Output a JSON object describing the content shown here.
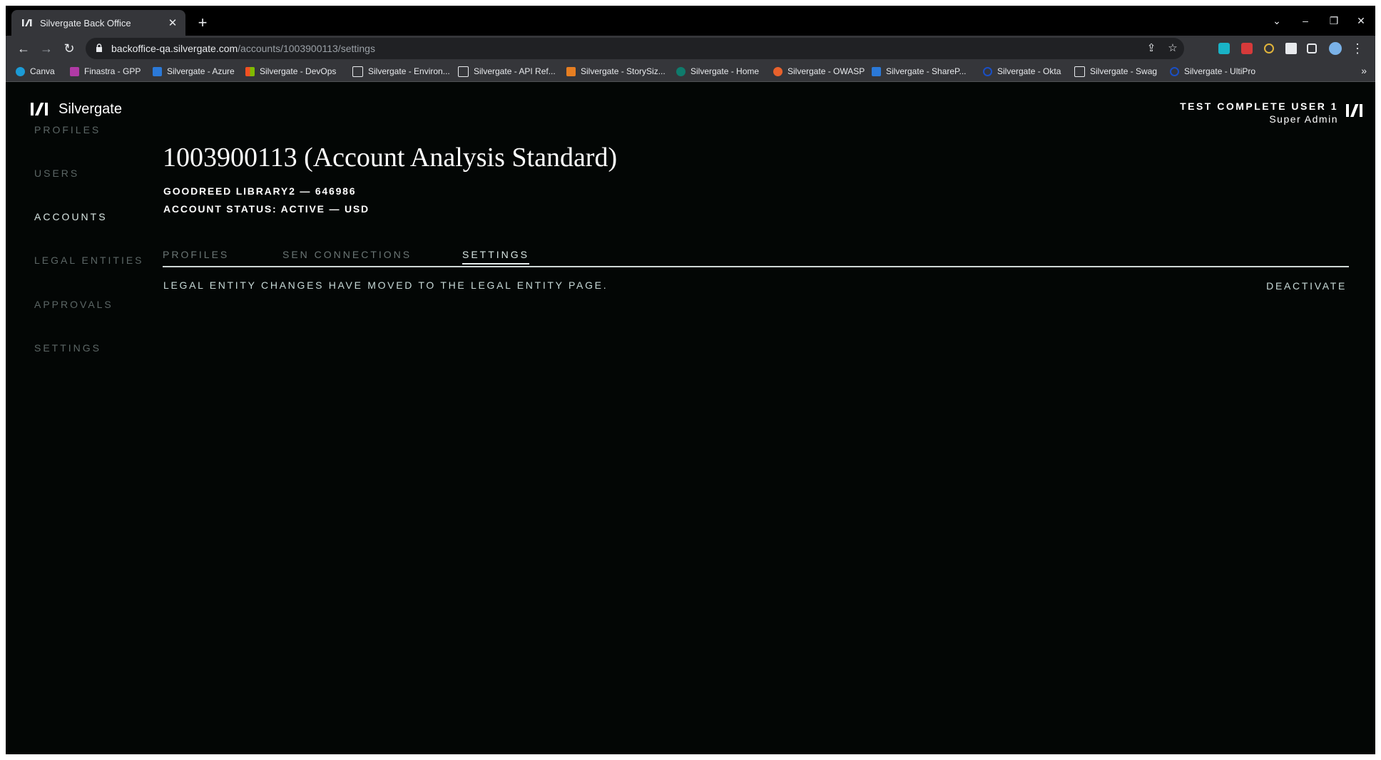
{
  "browser": {
    "tab_title": "Silvergate Back Office",
    "tab_close": "✕",
    "new_tab": "+",
    "url_host": "backoffice-qa.silvergate.com",
    "url_path": "/accounts/1003900113/settings",
    "window_controls": {
      "chevron": "⌄",
      "minimize": "–",
      "restore": "❐",
      "close": "✕"
    },
    "nav": {
      "back": "←",
      "forward": "→",
      "reload": "↻",
      "share": "⇪",
      "star": "☆",
      "menu": "⋮",
      "overflow": "»"
    },
    "bookmarks": [
      {
        "label": "Canva",
        "color": "#1c9bd6"
      },
      {
        "label": "Finastra - GPP",
        "color": "#b03aa5"
      },
      {
        "label": "Silvergate - Azure",
        "color": "#2b79d8"
      },
      {
        "label": "Silvergate - DevOps",
        "color": "#f25022"
      },
      {
        "label": "Silvergate - Environ...",
        "color": "#e8eaed"
      },
      {
        "label": "Silvergate - API Ref...",
        "color": "#e8eaed"
      },
      {
        "label": "Silvergate - StorySiz...",
        "color": "#e67e22"
      },
      {
        "label": "Silvergate - Home",
        "color": "#0f7b6c"
      },
      {
        "label": "Silvergate - OWASP",
        "color": "#e8612c"
      },
      {
        "label": "Silvergate - ShareP...",
        "color": "#2b79d8"
      },
      {
        "label": "Silvergate - Okta",
        "color": "#1a4fc4"
      },
      {
        "label": "Silvergate - Swag",
        "color": "#e8eaed"
      },
      {
        "label": "Silvergate - UltiPro",
        "color": "#1a4fc4"
      }
    ]
  },
  "app": {
    "brand": "Silvergate",
    "sidebar": [
      "PROFILES",
      "USERS",
      "ACCOUNTS",
      "LEGAL ENTITIES",
      "APPROVALS",
      "SETTINGS"
    ],
    "active_sidebar": "ACCOUNTS",
    "user": {
      "name": "TEST COMPLETE USER 1",
      "role": "Super Admin"
    },
    "account": {
      "title": "1003900113 (Account Analysis Standard)",
      "line1": "GOODREED LIBRARY2 — 646986",
      "line2": "ACCOUNT STATUS: ACTIVE — USD"
    },
    "tabs": [
      "PROFILES",
      "SEN CONNECTIONS",
      "SETTINGS"
    ],
    "active_tab": "SETTINGS",
    "notice": "LEGAL ENTITY CHANGES HAVE MOVED TO THE LEGAL ENTITY PAGE.",
    "deactivate": "DEACTIVATE"
  },
  "colors": {
    "background": "#030605",
    "accent_text": "#c8dad8",
    "nav_inactive": "#5c6766"
  }
}
